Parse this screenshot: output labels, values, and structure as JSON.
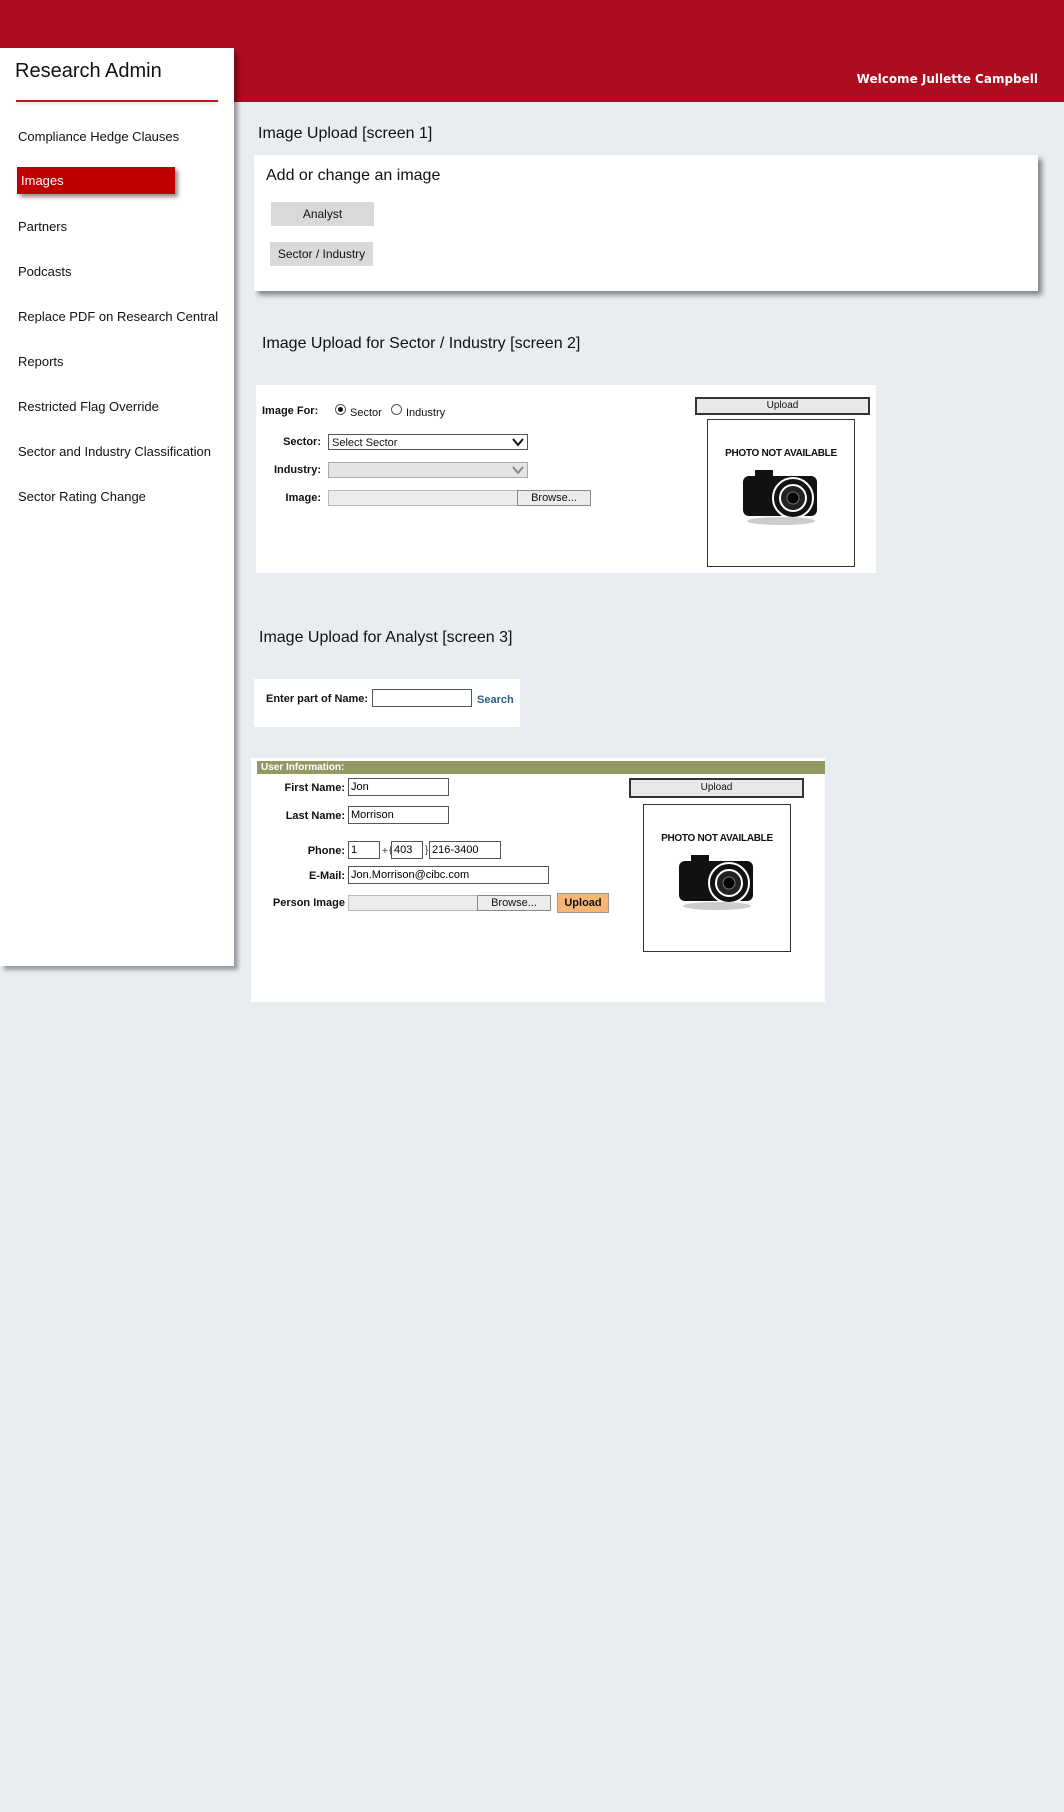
{
  "header": {
    "welcome": "Welcome Jullette Campbell"
  },
  "sidebar": {
    "title": "Research Admin",
    "items": [
      {
        "label": "Compliance Hedge Clauses"
      },
      {
        "label": "Images",
        "active": true
      },
      {
        "label": "Partners"
      },
      {
        "label": "Podcasts"
      },
      {
        "label": "Replace PDF on  Research Central"
      },
      {
        "label": "Reports"
      },
      {
        "label": "Restricted Flag Override"
      },
      {
        "label": "Sector and Industry Classification"
      },
      {
        "label": "Sector Rating Change"
      }
    ]
  },
  "screen1": {
    "title": "Image Upload  [screen 1]",
    "subtitle": "Add or change an image",
    "analyst_button": "Analyst",
    "sector_industry_button": "Sector / Industry"
  },
  "screen2": {
    "title": "Image Upload for Sector / Industry [screen 2]",
    "image_for_label": "Image For:",
    "radio_sector": "Sector",
    "radio_industry": "Industry",
    "selected_option": "Sector",
    "sector_label": "Sector:",
    "sector_value": "Select Sector",
    "industry_label": "Industry:",
    "industry_value": "",
    "image_label": "Image:",
    "browse_label": "Browse...",
    "upload_label": "Upload",
    "photo_text": "PHOTO NOT AVAILABLE"
  },
  "screen3": {
    "title": "Image Upload for Analyst [screen 3]",
    "search_label": "Enter part of Name:",
    "search_value": "",
    "search_link": "Search",
    "user_info_title": "User Information:",
    "first_name_label": "First Name:",
    "first_name_value": "Jon",
    "last_name_label": "Last Name:",
    "last_name_value": "Morrison",
    "phone_label": "Phone:",
    "phone_country": "1",
    "phone_area": "403",
    "phone_number": "216-3400",
    "phone_sep1": "+",
    "phone_sep2": "{",
    "phone_sep3": "}",
    "email_label": "E-Mail:",
    "email_value": "Jon.Morrison@cibc.com",
    "person_image_label": "Person Image",
    "browse_label": "Browse...",
    "upload_orange": "Upload",
    "upload_top": "Upload",
    "photo_text": "PHOTO NOT AVAILABLE"
  },
  "icons": {
    "camera": "camera-icon",
    "dropdown": "chevron-down-icon"
  }
}
